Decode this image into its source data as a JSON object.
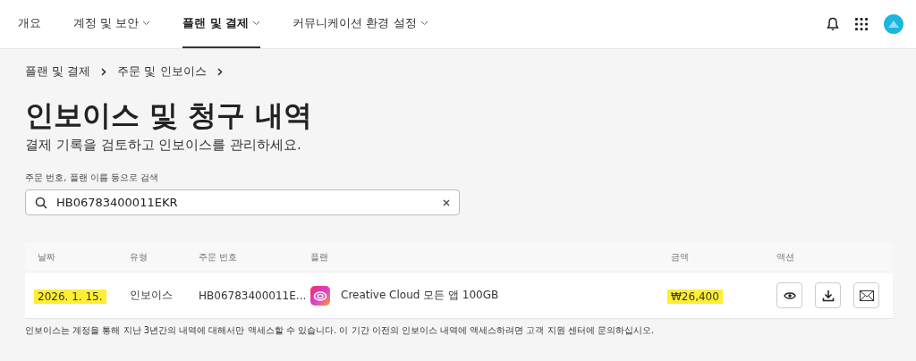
{
  "nav": {
    "tabs": [
      {
        "label": "개요",
        "selected": false,
        "dropdown": false
      },
      {
        "label": "계정 및 보안",
        "selected": false,
        "dropdown": true
      },
      {
        "label": "플랜 및 결제",
        "selected": true,
        "dropdown": true
      },
      {
        "label": "커뮤니케이션 환경 설정",
        "selected": false,
        "dropdown": true
      }
    ]
  },
  "breadcrumb": [
    "플랜 및 결제",
    "주문 및 인보이스"
  ],
  "title": "인보이스 및 청구 내역",
  "subtitle": "결제 기록을 검토하고 인보이스를 관리하세요.",
  "search": {
    "label": "주문 번호, 플랜 이름 등으로 검색",
    "value": "HB06783400011EKR"
  },
  "table": {
    "columns": [
      "날짜",
      "유형",
      "주문 번호",
      "플랜",
      "금액",
      "액션"
    ],
    "rows": [
      {
        "date": {
          "text": "2026. 1. 15.",
          "highlighted": true
        },
        "type": "인보이스",
        "order": "HB06783400011E...",
        "plan": "Creative Cloud 모든 앱 100GB",
        "amount": {
          "text": "₩26,400",
          "highlighted": true
        }
      }
    ]
  },
  "footnote": "인보이스는 계정을 통해 지난 3년간의 내역에 대해서만 액세스할 수 있습니다. 이 기간 이전의 인보이스 내역에 액세스하려면 고객 지원 센터에 문의하십시오."
}
